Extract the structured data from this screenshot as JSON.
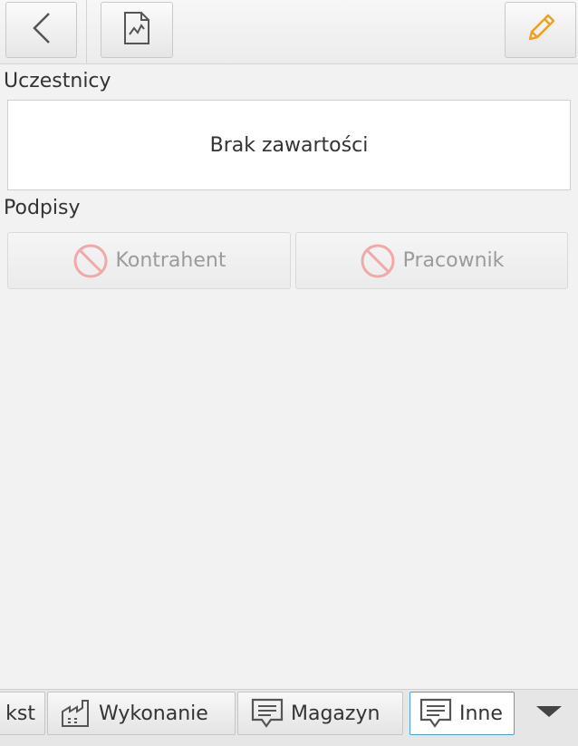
{
  "toolbar": {
    "back_icon": "chevron-left-icon",
    "document_icon": "document-chart-icon",
    "edit_icon": "pencil-icon",
    "accent_color": "#f0a020"
  },
  "participants": {
    "label": "Uczestnicy",
    "empty_text": "Brak zawartości"
  },
  "signatures": {
    "label": "Podpisy",
    "buttons": [
      {
        "label": "Kontrahent",
        "icon": "prohibited-icon"
      },
      {
        "label": "Pracownik",
        "icon": "prohibited-icon"
      }
    ],
    "icon_color": "#f0a8a8"
  },
  "tabs": [
    {
      "label": "kst",
      "icon": ""
    },
    {
      "label": "Wykonanie",
      "icon": "factory-icon"
    },
    {
      "label": "Magazyn",
      "icon": "comment-icon"
    },
    {
      "label": "Inne",
      "icon": "comment-icon",
      "selected": true
    }
  ],
  "tabs_more_icon": "triangle-down-icon"
}
